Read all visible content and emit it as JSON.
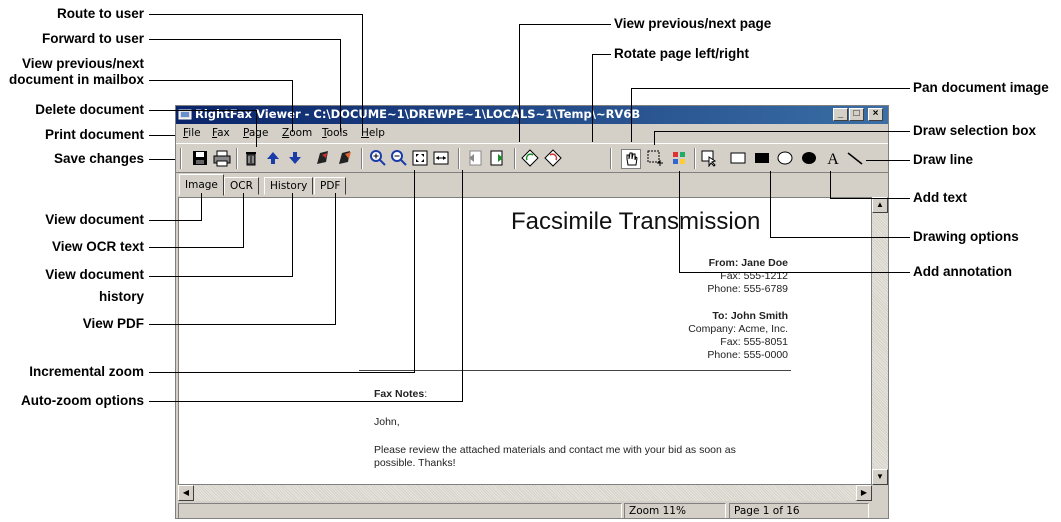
{
  "window": {
    "title": "RightFax Viewer - C:\\DOCUME~1\\DREWPE~1\\LOCALS~1\\Temp\\~RV6B",
    "minimize": "_",
    "maximize": "□",
    "close": "×"
  },
  "menu": [
    {
      "label": "File",
      "key": "F",
      "rest": "ile"
    },
    {
      "label": "Fax",
      "key": "F",
      "rest": "ax"
    },
    {
      "label": "Page",
      "key": "P",
      "rest": "age"
    },
    {
      "label": "Zoom",
      "key": "Z",
      "rest": "oom"
    },
    {
      "label": "Tools",
      "key": "T",
      "rest": "ools"
    },
    {
      "label": "Help",
      "key": "H",
      "rest": "elp"
    }
  ],
  "toolbar": {
    "icons": [
      "save-icon",
      "print-icon",
      "delete-icon",
      "up-arrow-icon",
      "down-arrow-icon",
      "route-icon",
      "forward-icon",
      "zoom-in-icon",
      "zoom-out-icon",
      "fit-page-icon",
      "fit-width-icon",
      "prev-page-icon",
      "next-page-icon",
      "rotate-left-icon",
      "rotate-right-icon",
      "pan-icon",
      "selection-box-icon",
      "annotation-icon",
      "drawing-options-icon",
      "rectangle-icon",
      "filled-rectangle-icon",
      "ellipse-icon",
      "filled-ellipse-icon",
      "text-icon",
      "line-icon"
    ]
  },
  "tabs": [
    "Image",
    "OCR",
    "History",
    "PDF"
  ],
  "document": {
    "title": "Facsimile Transmission",
    "from_name": "From: Jane Doe",
    "from_fax": "Fax: 555-1212",
    "from_phone": "Phone: 555-6789",
    "to_name": "To: John Smith",
    "to_company": "Company: Acme, Inc.",
    "to_fax": "Fax: 555-8051",
    "to_phone": "Phone: 555-0000",
    "notes_label": "Fax Notes",
    "notes_colon": ":",
    "salutation": "John,",
    "body_line1": "Please review the attached materials and contact me with your bid as soon as",
    "body_line2": "possible. Thanks!"
  },
  "status": {
    "zoom": "Zoom 11%",
    "page": "Page 1 of 16"
  },
  "callouts": {
    "route_to_user": "Route to user",
    "forward_to_user": "Forward to user",
    "view_prev_next_doc_1": "View previous/next",
    "view_prev_next_doc_2": "document in mailbox",
    "delete_document": "Delete document",
    "print_document": "Print document",
    "save_changes": "Save changes",
    "view_document": "View document",
    "view_ocr_text": "View OCR text",
    "view_document_history_1": "View document",
    "view_document_history_2": "history",
    "view_pdf": "View PDF",
    "incremental_zoom": "Incremental zoom",
    "auto_zoom_options": "Auto-zoom options",
    "view_prev_next_page": "View previous/next page",
    "rotate_page": "Rotate page left/right",
    "pan_document_image": "Pan document image",
    "draw_selection_box": "Draw selection box",
    "draw_line": "Draw line",
    "add_text": "Add text",
    "drawing_options": "Drawing options",
    "add_annotation": "Add annotation"
  }
}
